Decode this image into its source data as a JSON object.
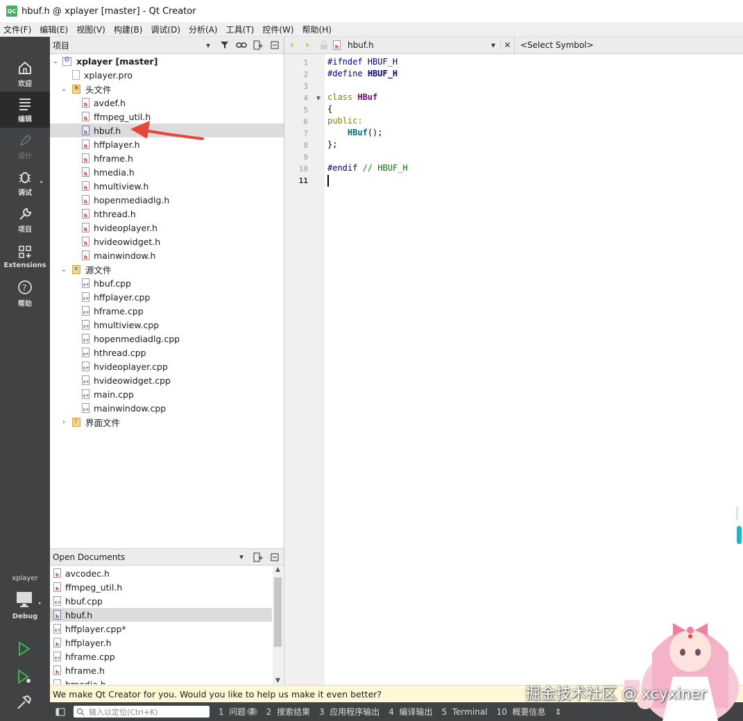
{
  "window": {
    "title": "hbuf.h @ xplayer [master] - Qt Creator",
    "app_icon": "QC"
  },
  "menu": [
    "文件(F)",
    "编辑(E)",
    "视图(V)",
    "构建(B)",
    "调试(D)",
    "分析(A)",
    "工具(T)",
    "控件(W)",
    "帮助(H)"
  ],
  "modes": [
    {
      "label": "欢迎",
      "icon": "home-icon"
    },
    {
      "label": "编辑",
      "icon": "edit-icon"
    },
    {
      "label": "设计",
      "icon": "design-icon"
    },
    {
      "label": "调试",
      "icon": "debug-bug-icon"
    },
    {
      "label": "项目",
      "icon": "wrench-icon"
    },
    {
      "label": "Extensions",
      "icon": "extensions-icon"
    },
    {
      "label": "帮助",
      "icon": "help-icon"
    }
  ],
  "kit": {
    "project": "xplayer",
    "config": "Debug"
  },
  "project_panel": {
    "title": "项目",
    "root": "xplayer [master]",
    "pro_file": "xplayer.pro",
    "headers_label": "头文件",
    "headers": [
      "avdef.h",
      "ffmpeg_util.h",
      "hbuf.h",
      "hffplayer.h",
      "hframe.h",
      "hmedia.h",
      "hmultiview.h",
      "hopenmediadlg.h",
      "hthread.h",
      "hvideoplayer.h",
      "hvideowidget.h",
      "mainwindow.h"
    ],
    "sources_label": "源文件",
    "sources": [
      "hbuf.cpp",
      "hffplayer.cpp",
      "hframe.cpp",
      "hmultiview.cpp",
      "hopenmediadlg.cpp",
      "hthread.cpp",
      "hvideoplayer.cpp",
      "hvideowidget.cpp",
      "main.cpp",
      "mainwindow.cpp"
    ],
    "forms_label": "界面文件",
    "selected": "hbuf.h"
  },
  "open_documents": {
    "title": "Open Documents",
    "items": [
      "avcodec.h",
      "ffmpeg_util.h",
      "hbuf.cpp",
      "hbuf.h",
      "hffplayer.cpp*",
      "hffplayer.h",
      "hframe.cpp",
      "hframe.h",
      "hmedia.h"
    ],
    "selected": "hbuf.h"
  },
  "editor": {
    "file": "hbuf.h",
    "symbol": "<Select Symbol>",
    "line_numbers": [
      "1",
      "2",
      "3",
      "4",
      "5",
      "6",
      "7",
      "8",
      "9",
      "10",
      "11"
    ],
    "current_line": "11",
    "code": {
      "l1a": "#ifndef",
      "l1b": "HBUF_H",
      "l2a": "#define",
      "l2b": "HBUF_H",
      "l4a": "class",
      "l4b": "HBuf",
      "l5": "{",
      "l6": "public:",
      "l7a": "HBuf",
      "l7b": "();",
      "l8": "};",
      "l10a": "#endif",
      "l10b": "// HBUF_H"
    }
  },
  "notice": "We make Qt Creator for you. Would you like to help us make it even better?",
  "statusbar": {
    "locator_placeholder": "输入以定位(Ctrl+K)",
    "panes": [
      {
        "num": "1",
        "label": "问题",
        "badge": "2"
      },
      {
        "num": "2",
        "label": "搜索结果"
      },
      {
        "num": "3",
        "label": "应用程序输出"
      },
      {
        "num": "4",
        "label": "编译输出"
      },
      {
        "num": "5",
        "label": "Terminal"
      },
      {
        "num": "10",
        "label": "概要信息"
      }
    ]
  },
  "watermark": "掘金技术社区 @ xcyxiner",
  "colors": {
    "modebar": "#404244",
    "accent_arrow": "#e8453c",
    "keyword": "#808000",
    "type": "#800080",
    "comment": "#008000"
  }
}
